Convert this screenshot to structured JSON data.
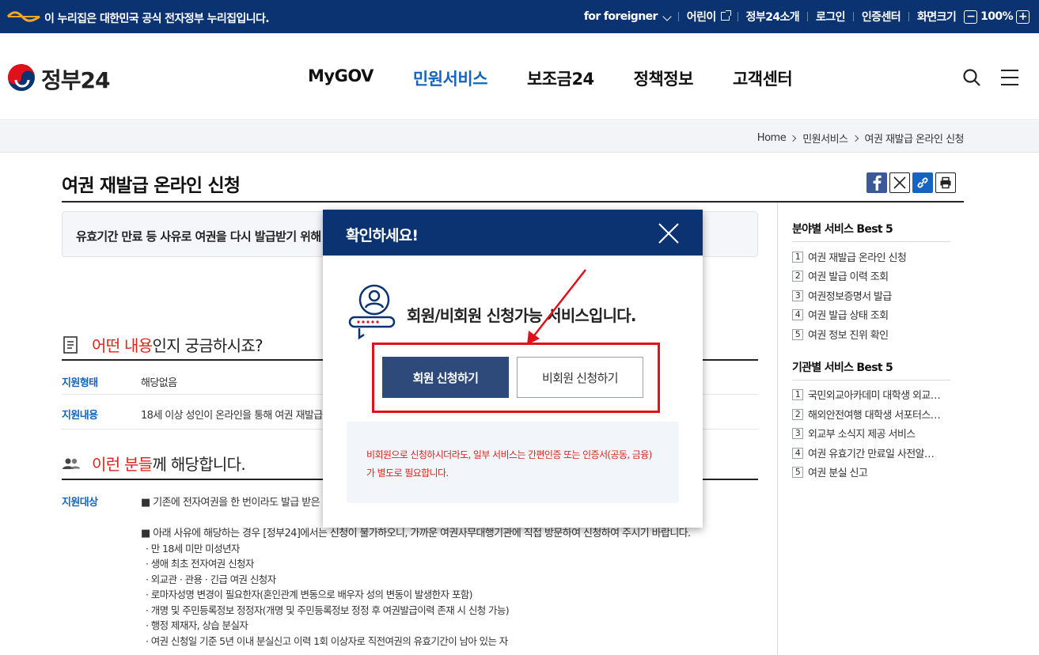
{
  "topbar": {
    "gov_notice": "이 누리집은 대한민국 공식 전자정부 누리집입니다.",
    "foreigner": "for foreigner",
    "kids": "어린이",
    "about": "정부24소개",
    "login": "로그인",
    "cert": "인증센터",
    "screen_size": "화면크기",
    "zoom_minus": "−",
    "zoom_value": "100%",
    "zoom_plus": "+"
  },
  "header": {
    "logo": "정부24",
    "nav": [
      "MyGOV",
      "민원서비스",
      "보조금24",
      "정책정보",
      "고객센터"
    ],
    "active_nav": "민원서비스"
  },
  "breadcrumb": [
    "Home",
    "민원서비스",
    "여권 재발급 온라인 신청"
  ],
  "page": {
    "title": "여권 재발급 온라인 신청",
    "summary": "유효기간 만료 등 사유로 여권을 다시 발급받기 위해 신"
  },
  "section1": {
    "heading_highlight": "어떤 내용",
    "heading_rest": "인지 궁금하시죠?",
    "rows": [
      {
        "label": "지원형태",
        "value": "해당없음"
      },
      {
        "label": "지원내용",
        "value": "18세 이상 성인이 온라인을 통해 여권 재발급 신청"
      }
    ]
  },
  "section2": {
    "heading_highlight": "이런 분들",
    "heading_rest": "께 해당합니다.",
    "label": "지원대상",
    "line1": "■ 기존에 전자여권을 한 번이라도 발급 받은 이력",
    "line2": "■ 아래 사유에 해당하는 경우 [정부24]에서는 신청이 불가하오니, 가까운 여권사무대행기관에 직접 방문하여 신청하여 주시기 바랍니다.",
    "bullets": [
      "· 만 18세 미만 미성년자",
      "· 생애 최초 전자여권 신청자",
      "· 외교관 · 관용 · 긴급 여권 신청자",
      "· 로마자성명 변경이 필요한자(혼인관계 변동으로 배우자 성의 변동이 발생한자 포함)",
      "· 개명 및 주민등록정보 정정자(개명 및 주민등록정보 정정 후 여권발급이력 존재 시 신청 가능)",
      "· 행정 제재자, 상습 분실자",
      "· 여권 신청일 기준 5년 이내 분실신고 이력 1회 이상자로 직전여권의 유효기간이 남아 있는 자"
    ]
  },
  "sidebar": {
    "best_field_title": "분야별 서비스 Best 5",
    "best_field": [
      {
        "num": "1",
        "label": "여권 재발급 온라인 신청"
      },
      {
        "num": "2",
        "label": "여권 발급 이력 조회"
      },
      {
        "num": "3",
        "label": "여권정보증명서 발급"
      },
      {
        "num": "4",
        "label": "여권 발급 상태 조회"
      },
      {
        "num": "5",
        "label": "여권 정보 진위 확인"
      }
    ],
    "best_org_title": "기관별 서비스 Best 5",
    "best_org": [
      {
        "num": "1",
        "label": "국민외교아카데미 대학생 외교…"
      },
      {
        "num": "2",
        "label": "해외안전여행 대학생 서포터스…"
      },
      {
        "num": "3",
        "label": "외교부 소식지 제공 서비스"
      },
      {
        "num": "4",
        "label": "여권 유효기간 만료일 사전알…"
      },
      {
        "num": "5",
        "label": "여권 분실 신고"
      }
    ]
  },
  "modal": {
    "title": "확인하세요!",
    "message": "회원/비회원 신청가능 서비스입니다.",
    "member_button": "회원 신청하기",
    "guest_button": "비회원 신청하기",
    "notice_line1": "비회원으로 신청하시더라도, 일부 서비스는 간편인증 또는 인증서(공동, 금융)",
    "notice_line2": "가 별도로 필요합니다."
  },
  "colors": {
    "navy": "#0b3372",
    "accent_blue": "#1565c0",
    "button_navy": "#2e4a7a",
    "highlight_red": "#e1101a"
  }
}
